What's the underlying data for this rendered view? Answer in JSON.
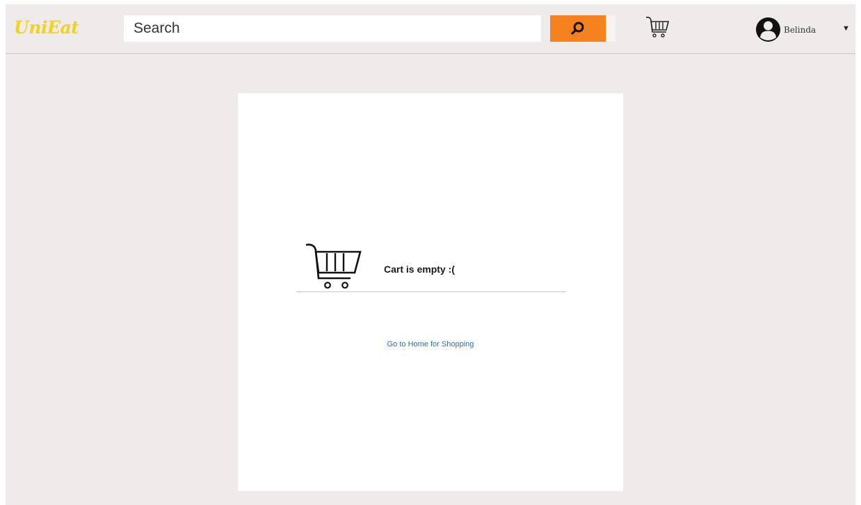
{
  "header": {
    "logo": "UniEat",
    "search": {
      "placeholder": "Search",
      "value": ""
    },
    "search_button_icon": "search-icon",
    "cart_icon": "cart-icon",
    "user": {
      "name": "Belinda",
      "avatar_icon": "user-avatar-icon",
      "menu_icon": "caret-down-icon"
    }
  },
  "cart": {
    "icon": "cart-icon",
    "message": "Cart is empty :(",
    "home_link": "Go to Home for Shopping"
  },
  "colors": {
    "background": "#efebea",
    "logo": "#f2d21c",
    "search_button": "#f5811f",
    "link": "#2e6fa8",
    "card": "#ffffff"
  }
}
